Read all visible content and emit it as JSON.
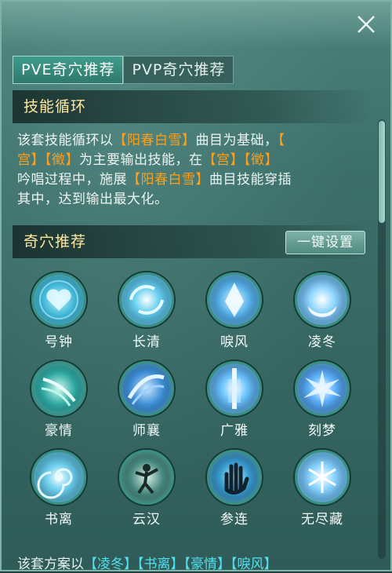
{
  "tabs": [
    {
      "label": "PVE奇穴推荐",
      "active": true
    },
    {
      "label": "PVP奇穴推荐",
      "active": false
    }
  ],
  "rotation": {
    "title": "技能循环",
    "line1_a": "该套技能循环以",
    "line1_b": "【阳春白雪】",
    "line1_c": "曲目为基础，",
    "line1_d": "【",
    "line2_a": "宫】【徵】",
    "line2_b": "为主要输出技能，在",
    "line2_c": "【宫】【徵】",
    "line3_a": "吟唱过程中，施展",
    "line3_b": "【阳春白雪】",
    "line3_c": "曲目技能穿插",
    "line4": "其中，达到输出最大化。"
  },
  "talents": {
    "title": "奇穴推荐",
    "one_key_label": "一键设置",
    "skills": [
      {
        "name": "号钟",
        "icon": "heart-swirl-icon"
      },
      {
        "name": "长清",
        "icon": "vortex-icon"
      },
      {
        "name": "唳风",
        "icon": "crystal-icon"
      },
      {
        "name": "凌冬",
        "icon": "crescent-icon"
      },
      {
        "name": "豪情",
        "icon": "wind-slash-icon"
      },
      {
        "name": "师襄",
        "icon": "wave-slash-icon"
      },
      {
        "name": "广雅",
        "icon": "light-beam-icon"
      },
      {
        "name": "刻梦",
        "icon": "burst-icon"
      },
      {
        "name": "书离",
        "icon": "spiral-icon"
      },
      {
        "name": "云汉",
        "icon": "warrior-icon"
      },
      {
        "name": "参连",
        "icon": "hand-icon"
      },
      {
        "name": "无尽藏",
        "icon": "snowflake-icon"
      }
    ]
  },
  "bottom": {
    "prefix": "该套方案以",
    "items": "【凌冬】【书离】【豪情】【唳风】"
  },
  "colors": {
    "highlight": "#ff9f1a",
    "header_text": "#ffe7a0",
    "cyan_highlight": "#52e0f0"
  }
}
